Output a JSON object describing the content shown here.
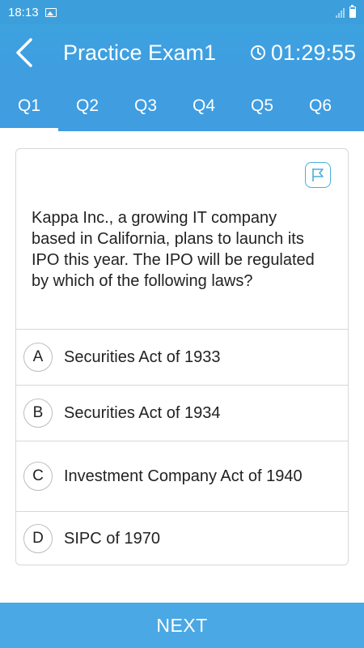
{
  "status_bar": {
    "time": "18:13",
    "icons": [
      "image-icon",
      "signal-icon",
      "battery-icon"
    ]
  },
  "header": {
    "title": "Practice Exam1",
    "timer": "01:29:55",
    "back_icon": "chevron-left-icon",
    "timer_icon": "clock-icon"
  },
  "tabs": [
    {
      "label": "Q1",
      "active": true
    },
    {
      "label": "Q2",
      "active": false
    },
    {
      "label": "Q3",
      "active": false
    },
    {
      "label": "Q4",
      "active": false
    },
    {
      "label": "Q5",
      "active": false
    },
    {
      "label": "Q6",
      "active": false
    }
  ],
  "question": {
    "flag_icon": "flag-icon",
    "text": "Kappa Inc., a growing IT company based in California, plans to launch its IPO this year. The IPO will be regulated by which of the following laws?",
    "options": [
      {
        "letter": "A",
        "text": "Securities Act of 1933"
      },
      {
        "letter": "B",
        "text": "Securities Act of 1934"
      },
      {
        "letter": "C",
        "text": "Investment Company Act of 1940"
      },
      {
        "letter": "D",
        "text": "SIPC of 1970"
      }
    ]
  },
  "footer": {
    "next_label": "NEXT"
  },
  "colors": {
    "primary": "#3f9de0",
    "next_button": "#4aa8e4",
    "flag_accent": "#4aaed9"
  }
}
